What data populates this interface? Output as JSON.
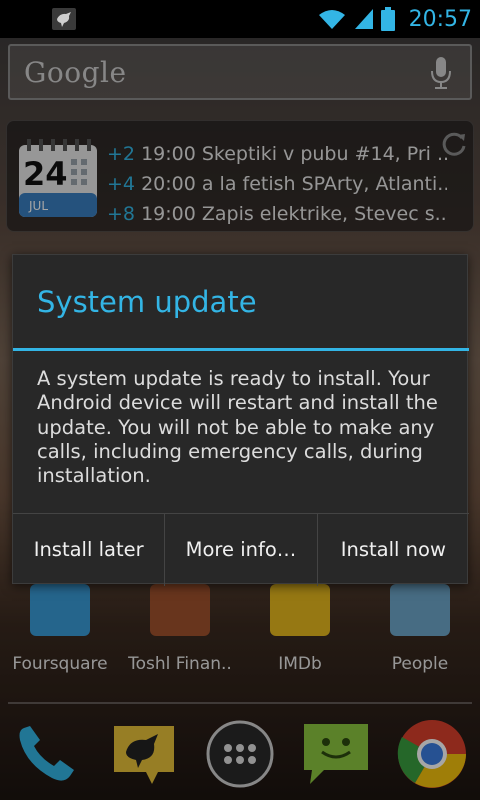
{
  "status_bar": {
    "time": "20:57",
    "notification_icon": "bird-notification-icon",
    "icons": [
      "wifi-icon",
      "signal-icon",
      "battery-icon"
    ]
  },
  "search": {
    "logo_text": "Google",
    "mic_icon": "mic-icon"
  },
  "calendar_widget": {
    "day": "24",
    "month": "JUL",
    "events": [
      {
        "count": "+2",
        "text": "19:00 Skeptiki v pubu #14, Pri ..."
      },
      {
        "count": "+4",
        "text": "20:00 a la fetish SPArty, Atlanti..."
      },
      {
        "count": "+8",
        "text": "19:00 Zapis elektrike, Stevec s..."
      }
    ],
    "refresh_icon": "refresh-icon"
  },
  "apps": [
    {
      "label": "Foursquare",
      "icon": "foursquare-icon",
      "color": "#3a9bd8"
    },
    {
      "label": "Toshl Finan..",
      "icon": "wallet-icon",
      "color": "#a0522d"
    },
    {
      "label": "IMDb",
      "icon": "imdb-icon",
      "color": "#e6b91e"
    },
    {
      "label": "People",
      "icon": "people-icon",
      "color": "#6ea7c9"
    }
  ],
  "dock": [
    {
      "name": "phone-icon"
    },
    {
      "name": "bird-app-icon"
    },
    {
      "name": "app-drawer-icon"
    },
    {
      "name": "messaging-icon"
    },
    {
      "name": "chrome-icon"
    }
  ],
  "dialog": {
    "title": "System update",
    "message": "A system update is ready to install. Your Android device will restart and install the update. You will not be able to make any calls, including emergency calls, during installation.",
    "buttons": {
      "later": "Install later",
      "more": "More info…",
      "now": "Install now"
    }
  },
  "colors": {
    "accent": "#33b5e5",
    "dialog_bg": "#282828"
  }
}
